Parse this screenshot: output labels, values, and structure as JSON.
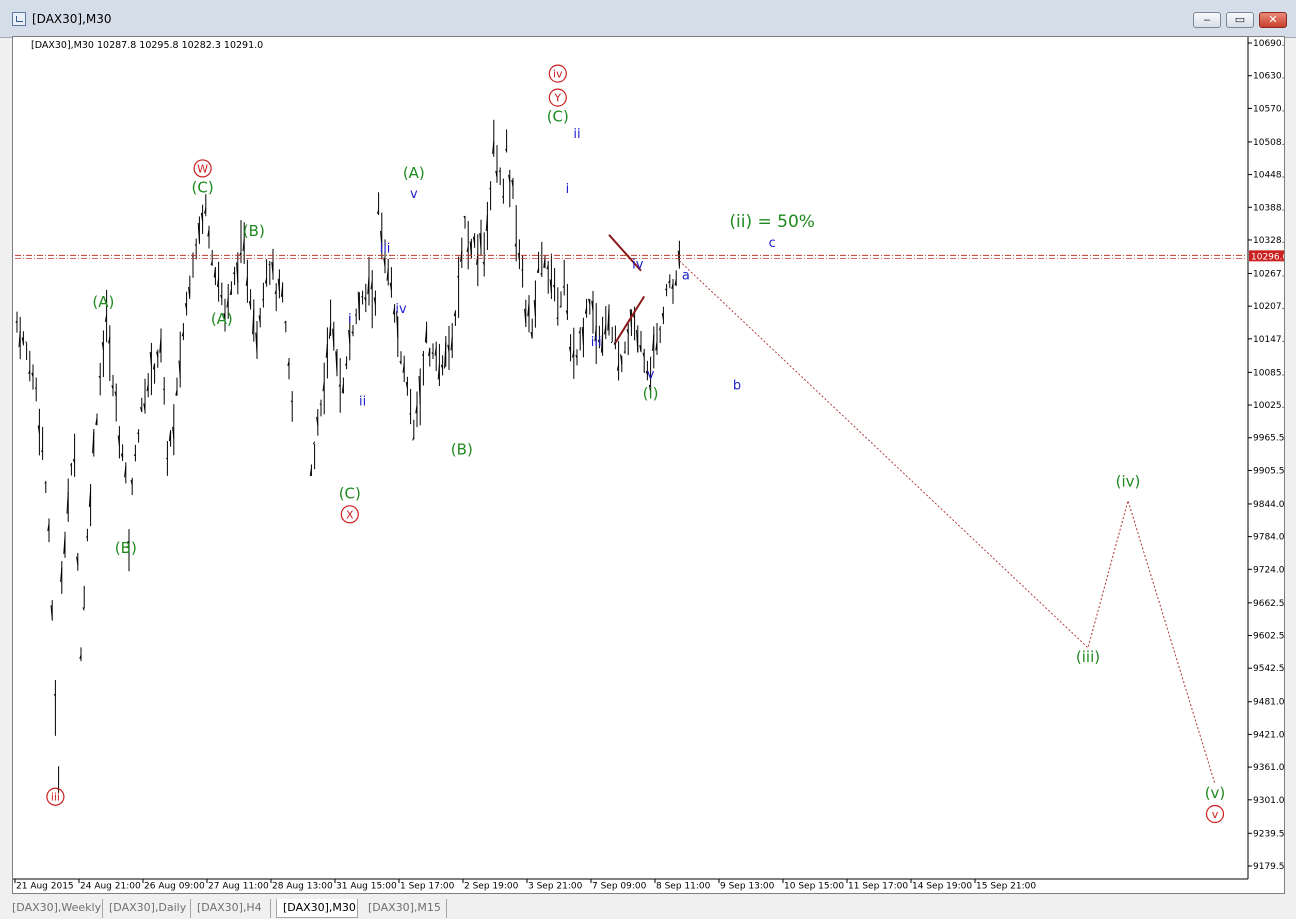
{
  "window": {
    "title": "[DAX30],M30",
    "minimize": "‒",
    "maximize": "▭",
    "close": "✕"
  },
  "chart_data": {
    "type": "candlestick",
    "info": "[DAX30],M30  10287.8 10295.8 10282.3 10291.0",
    "price_axis": [
      "10690.0",
      "10630.0",
      "10570.0",
      "10508.5",
      "10448.5",
      "10388.5",
      "10328.5",
      "10267.0",
      "10207.0",
      "10147.0",
      "10085.5",
      "10025.5",
      "9965.5",
      "9905.5",
      "9844.0",
      "9784.0",
      "9724.0",
      "9662.5",
      "9602.5",
      "9542.5",
      "9481.0",
      "9421.0",
      "9361.0",
      "9301.0",
      "9239.5",
      "9179.5"
    ],
    "time_axis": [
      "21 Aug 2015",
      "24 Aug 21:00",
      "26 Aug 09:00",
      "27 Aug 11:00",
      "28 Aug 13:00",
      "31 Aug 15:00",
      "1 Sep 17:00",
      "2 Sep 19:00",
      "3 Sep 21:00",
      "7 Sep 09:00",
      "8 Sep 11:00",
      "9 Sep 13:00",
      "10 Sep 15:00",
      "11 Sep 17:00",
      "14 Sep 19:00",
      "15 Sep 21:00"
    ],
    "current_price": "10296.6",
    "ylim": [
      9179.5,
      10690.0
    ],
    "price_path": [
      [
        0,
        10180
      ],
      [
        3,
        10120
      ],
      [
        6,
        10060
      ],
      [
        8,
        9950
      ],
      [
        9,
        9880
      ],
      [
        10,
        9780
      ],
      [
        11,
        9650
      ],
      [
        12,
        9480
      ],
      [
        13,
        9320
      ],
      [
        14,
        9720
      ],
      [
        16,
        9850
      ],
      [
        18,
        9940
      ],
      [
        20,
        9570
      ],
      [
        22,
        9780
      ],
      [
        24,
        9950
      ],
      [
        26,
        10080
      ],
      [
        28,
        10180
      ],
      [
        30,
        10060
      ],
      [
        32,
        9980
      ],
      [
        34,
        9890
      ],
      [
        35,
        9780
      ],
      [
        37,
        9950
      ],
      [
        40,
        10040
      ],
      [
        42,
        10090
      ],
      [
        45,
        10130
      ],
      [
        47,
        9940
      ],
      [
        49,
        9980
      ],
      [
        51,
        10110
      ],
      [
        53,
        10210
      ],
      [
        55,
        10300
      ],
      [
        57,
        10350
      ],
      [
        59,
        10390
      ],
      [
        61,
        10310
      ],
      [
        63,
        10250
      ],
      [
        65,
        10200
      ],
      [
        67,
        10230
      ],
      [
        69,
        10290
      ],
      [
        71,
        10300
      ],
      [
        73,
        10230
      ],
      [
        75,
        10150
      ],
      [
        77,
        10250
      ],
      [
        79,
        10290
      ],
      [
        81,
        10240
      ],
      [
        83,
        10220
      ],
      [
        86,
        10020
      ],
      [
        88,
        9960
      ],
      [
        90,
        10010
      ],
      [
        92,
        9900
      ],
      [
        94,
        9990
      ],
      [
        96,
        10070
      ],
      [
        98,
        10160
      ],
      [
        100,
        10100
      ],
      [
        102,
        10050
      ],
      [
        104,
        10150
      ],
      [
        106,
        10190
      ],
      [
        108,
        10210
      ],
      [
        110,
        10240
      ],
      [
        112,
        10230
      ],
      [
        113,
        10380
      ],
      [
        115,
        10280
      ],
      [
        117,
        10230
      ],
      [
        119,
        10160
      ],
      [
        121,
        10080
      ],
      [
        123,
        10030
      ],
      [
        124,
        9980
      ],
      [
        126,
        10060
      ],
      [
        128,
        10140
      ],
      [
        130,
        10110
      ],
      [
        132,
        10110
      ],
      [
        134,
        10100
      ],
      [
        136,
        10150
      ],
      [
        138,
        10240
      ],
      [
        140,
        10360
      ],
      [
        142,
        10330
      ],
      [
        144,
        10290
      ],
      [
        146,
        10330
      ],
      [
        148,
        10400
      ],
      [
        149,
        10520
      ],
      [
        150,
        10460
      ],
      [
        152,
        10440
      ],
      [
        153,
        10490
      ],
      [
        155,
        10410
      ],
      [
        157,
        10300
      ],
      [
        159,
        10200
      ],
      [
        161,
        10160
      ],
      [
        163,
        10290
      ],
      [
        165,
        10300
      ],
      [
        167,
        10240
      ],
      [
        169,
        10200
      ],
      [
        171,
        10250
      ],
      [
        173,
        10130
      ],
      [
        175,
        10100
      ],
      [
        177,
        10170
      ],
      [
        179,
        10220
      ],
      [
        181,
        10160
      ],
      [
        183,
        10160
      ],
      [
        185,
        10190
      ],
      [
        187,
        10130
      ],
      [
        189,
        10100
      ],
      [
        191,
        10160
      ],
      [
        193,
        10180
      ],
      [
        195,
        10150
      ],
      [
        197,
        10080
      ],
      [
        198,
        10090
      ],
      [
        200,
        10150
      ],
      [
        202,
        10200
      ],
      [
        204,
        10240
      ],
      [
        206,
        10260
      ],
      [
        207,
        10290
      ]
    ],
    "projection": [
      [
        207,
        10290
      ],
      [
        227,
        9580
      ],
      [
        237,
        9850
      ],
      [
        252,
        9330
      ]
    ],
    "labels": [
      {
        "t": "ⓘⓘⓘ",
        "k": "circ",
        "s": "iii",
        "c": "red",
        "i": 12,
        "p": 9325,
        "pos": "below"
      },
      {
        "k": "txt",
        "s": "(A)",
        "c": "green",
        "i": 27,
        "p": 10180,
        "pos": "above"
      },
      {
        "k": "txt",
        "s": "(B)",
        "c": "green",
        "i": 34,
        "p": 9780,
        "pos": "below"
      },
      {
        "k": "circ",
        "s": "W",
        "c": "red",
        "i": 58,
        "p": 10390,
        "pos": "above2"
      },
      {
        "k": "txt",
        "s": "(C)",
        "c": "green",
        "i": 58,
        "p": 10390,
        "pos": "above"
      },
      {
        "k": "txt",
        "s": "(A)",
        "c": "green",
        "i": 64,
        "p": 10200,
        "pos": "below"
      },
      {
        "k": "txt",
        "s": "(B)",
        "c": "green",
        "i": 74,
        "p": 10310,
        "pos": "above"
      },
      {
        "k": "txt",
        "s": "(C)",
        "c": "green",
        "i": 104,
        "p": 9880,
        "pos": "below"
      },
      {
        "k": "circ",
        "s": "X",
        "c": "red",
        "i": 104,
        "p": 9880,
        "pos": "below2"
      },
      {
        "k": "txt",
        "s": "i",
        "c": "blue",
        "i": 104,
        "p": 10150,
        "pos": "above"
      },
      {
        "k": "txt",
        "s": "ii",
        "c": "blue",
        "i": 108,
        "p": 10050,
        "pos": "below"
      },
      {
        "k": "txt",
        "s": "iii",
        "c": "blue",
        "i": 115,
        "p": 10280,
        "pos": "above"
      },
      {
        "k": "txt",
        "s": "iv",
        "c": "blue",
        "i": 120,
        "p": 10220,
        "pos": "below"
      },
      {
        "k": "txt",
        "s": "v",
        "c": "blue",
        "i": 124,
        "p": 10380,
        "pos": "above"
      },
      {
        "k": "txt",
        "s": "(A)",
        "c": "green",
        "i": 124,
        "p": 10380,
        "pos": "above2"
      },
      {
        "k": "txt",
        "s": "(B)",
        "c": "green",
        "i": 139,
        "p": 9960,
        "pos": "below"
      },
      {
        "k": "txt",
        "s": "(C)",
        "c": "green",
        "i": 169,
        "p": 10520,
        "pos": "above"
      },
      {
        "k": "circ",
        "s": "Y",
        "c": "red",
        "i": 169,
        "p": 10520,
        "pos": "above2"
      },
      {
        "k": "circ",
        "s": "iv",
        "c": "red",
        "i": 169,
        "p": 10520,
        "pos": "above3"
      },
      {
        "k": "txt",
        "s": "i",
        "c": "blue",
        "i": 172,
        "p": 10440,
        "pos": "below"
      },
      {
        "k": "txt",
        "s": "ii",
        "c": "blue",
        "i": 175,
        "p": 10490,
        "pos": "above"
      },
      {
        "k": "txt",
        "s": "iii",
        "c": "blue",
        "i": 181,
        "p": 10160,
        "pos": "below"
      },
      {
        "k": "txt",
        "s": "iv",
        "c": "blue",
        "i": 194,
        "p": 10250,
        "pos": "above"
      },
      {
        "k": "txt",
        "s": "v",
        "c": "blue",
        "i": 198,
        "p": 10100,
        "pos": "below"
      },
      {
        "k": "txt",
        "s": "(i)",
        "c": "green",
        "i": 198,
        "p": 10100,
        "pos": "below2"
      },
      {
        "k": "txt",
        "s": "a",
        "c": "blue",
        "i": 209,
        "p": 10230,
        "pos": "above"
      },
      {
        "k": "txt",
        "s": "b",
        "c": "blue",
        "i": 225,
        "p": 10080,
        "pos": "below"
      },
      {
        "k": "txt",
        "s": "c",
        "c": "blue",
        "i": 236,
        "p": 10290,
        "pos": "above"
      },
      {
        "k": "txt",
        "s": "(ii) = 50%",
        "c": "green",
        "i": 236,
        "p": 10290,
        "pos": "above2"
      },
      {
        "k": "txt",
        "s": "(iii)",
        "c": "green",
        "i": 258,
        "p": 9580,
        "pos": "below"
      },
      {
        "k": "txt",
        "s": "(iv)",
        "c": "green",
        "i": 268,
        "p": 9850,
        "pos": "above"
      },
      {
        "k": "txt",
        "s": "(v)",
        "c": "green",
        "i": 283,
        "p": 9330,
        "pos": "below"
      },
      {
        "k": "circ",
        "s": "v",
        "c": "red",
        "i": 283,
        "p": 9330,
        "pos": "below2"
      }
    ]
  },
  "tabs": [
    "[DAX30],Weekly",
    "[DAX30],Daily",
    "[DAX30],H4",
    "[DAX30],M30",
    "[DAX30],M15"
  ],
  "active_tab": "[DAX30],M30"
}
